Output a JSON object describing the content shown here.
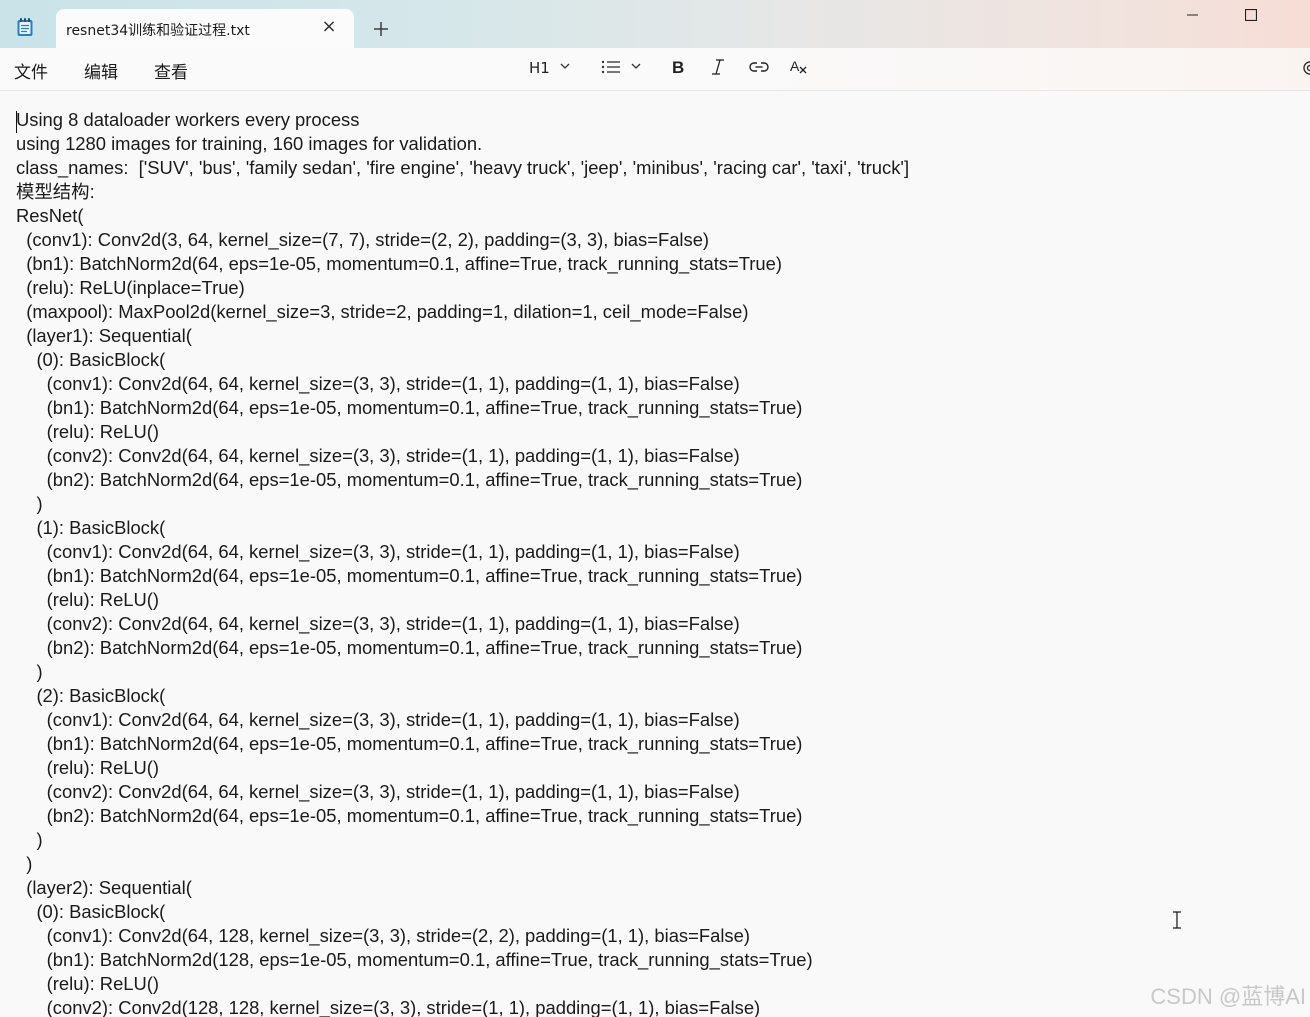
{
  "window": {
    "tab_title": "resnet34训练和验证过程.txt",
    "close_tab_glyph": "×",
    "new_tab_icon": "plus-icon",
    "controls": [
      "minimize-icon",
      "maximize-icon"
    ]
  },
  "menu": {
    "file": "文件",
    "edit": "编辑",
    "view": "查看"
  },
  "toolbar": {
    "heading": "H1",
    "icons": [
      "chevron-down-icon",
      "list-icon",
      "bold-icon",
      "italic-icon",
      "link-icon",
      "clear-format-icon",
      "settings-icon"
    ]
  },
  "editor": {
    "lines": [
      "Using 8 dataloader workers every process",
      "using 1280 images for training, 160 images for validation.",
      "class_names:  ['SUV', 'bus', 'family sedan', 'fire engine', 'heavy truck', 'jeep', 'minibus', 'racing car', 'taxi', 'truck']",
      "模型结构:",
      "ResNet(",
      "  (conv1): Conv2d(3, 64, kernel_size=(7, 7), stride=(2, 2), padding=(3, 3), bias=False)",
      "  (bn1): BatchNorm2d(64, eps=1e-05, momentum=0.1, affine=True, track_running_stats=True)",
      "  (relu): ReLU(inplace=True)",
      "  (maxpool): MaxPool2d(kernel_size=3, stride=2, padding=1, dilation=1, ceil_mode=False)",
      "  (layer1): Sequential(",
      "    (0): BasicBlock(",
      "      (conv1): Conv2d(64, 64, kernel_size=(3, 3), stride=(1, 1), padding=(1, 1), bias=False)",
      "      (bn1): BatchNorm2d(64, eps=1e-05, momentum=0.1, affine=True, track_running_stats=True)",
      "      (relu): ReLU()",
      "      (conv2): Conv2d(64, 64, kernel_size=(3, 3), stride=(1, 1), padding=(1, 1), bias=False)",
      "      (bn2): BatchNorm2d(64, eps=1e-05, momentum=0.1, affine=True, track_running_stats=True)",
      "    )",
      "    (1): BasicBlock(",
      "      (conv1): Conv2d(64, 64, kernel_size=(3, 3), stride=(1, 1), padding=(1, 1), bias=False)",
      "      (bn1): BatchNorm2d(64, eps=1e-05, momentum=0.1, affine=True, track_running_stats=True)",
      "      (relu): ReLU()",
      "      (conv2): Conv2d(64, 64, kernel_size=(3, 3), stride=(1, 1), padding=(1, 1), bias=False)",
      "      (bn2): BatchNorm2d(64, eps=1e-05, momentum=0.1, affine=True, track_running_stats=True)",
      "    )",
      "    (2): BasicBlock(",
      "      (conv1): Conv2d(64, 64, kernel_size=(3, 3), stride=(1, 1), padding=(1, 1), bias=False)",
      "      (bn1): BatchNorm2d(64, eps=1e-05, momentum=0.1, affine=True, track_running_stats=True)",
      "      (relu): ReLU()",
      "      (conv2): Conv2d(64, 64, kernel_size=(3, 3), stride=(1, 1), padding=(1, 1), bias=False)",
      "      (bn2): BatchNorm2d(64, eps=1e-05, momentum=0.1, affine=True, track_running_stats=True)",
      "    )",
      "  )",
      "  (layer2): Sequential(",
      "    (0): BasicBlock(",
      "      (conv1): Conv2d(64, 128, kernel_size=(3, 3), stride=(2, 2), padding=(1, 1), bias=False)",
      "      (bn1): BatchNorm2d(128, eps=1e-05, momentum=0.1, affine=True, track_running_stats=True)",
      "      (relu): ReLU()",
      "      (conv2): Conv2d(128, 128, kernel_size=(3, 3), stride=(1, 1), padding=(1, 1), bias=False)"
    ]
  },
  "watermark": "CSDN @蓝博AI"
}
